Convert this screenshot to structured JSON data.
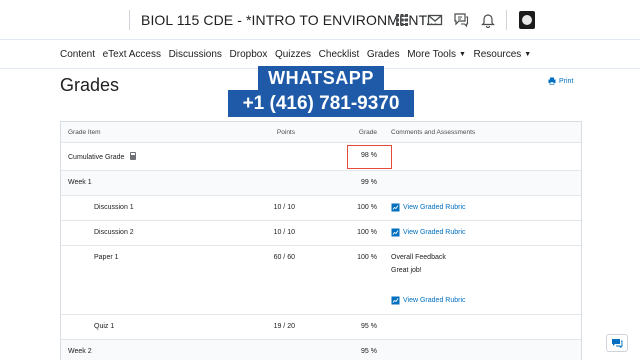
{
  "header": {
    "course_title": "BIOL 115 CDE - *INTRO TO ENVIRONMENT...",
    "icons": [
      "apps-grid-icon",
      "mail-icon",
      "chat-bubbles-icon",
      "bell-icon",
      "avatar"
    ]
  },
  "nav": {
    "items": [
      {
        "label": "Content"
      },
      {
        "label": "eText Access"
      },
      {
        "label": "Discussions"
      },
      {
        "label": "Dropbox"
      },
      {
        "label": "Quizzes"
      },
      {
        "label": "Checklist"
      },
      {
        "label": "Grades"
      },
      {
        "label": "More Tools",
        "dropdown": true
      },
      {
        "label": "Resources",
        "dropdown": true
      }
    ]
  },
  "page": {
    "title": "Grades",
    "print_label": "Print"
  },
  "watermark": {
    "line1": "WHATSAPP",
    "line2": "+1 (416) 781-9370"
  },
  "table": {
    "headers": {
      "item": "Grade Item",
      "points": "Points",
      "grade": "Grade",
      "comments": "Comments and Assessments"
    },
    "rows": [
      {
        "item": "Cumulative Grade",
        "points": "",
        "grade": "98 %",
        "comment": "",
        "rubric": ""
      },
      {
        "item": "Week 1",
        "points": "",
        "grade": "99 %",
        "comment": "",
        "rubric": ""
      },
      {
        "item": "Discussion 1",
        "points": "10 / 10",
        "grade": "100 %",
        "comment": "",
        "rubric": "View Graded Rubric"
      },
      {
        "item": "Discussion 2",
        "points": "10 / 10",
        "grade": "100 %",
        "comment": "",
        "rubric": "View Graded Rubric"
      },
      {
        "item": "Paper 1",
        "points": "60 / 60",
        "grade": "100 %",
        "comment_title": "Overall Feedback",
        "comment": "Great job!",
        "rubric": "View Graded Rubric"
      },
      {
        "item": "Quiz 1",
        "points": "19 / 20",
        "grade": "95 %",
        "comment": "",
        "rubric": ""
      },
      {
        "item": "Week 2",
        "points": "",
        "grade": "95 %",
        "comment": "",
        "rubric": ""
      }
    ]
  },
  "colors": {
    "link": "#006fbf",
    "highlight_box": "#e24a3b",
    "watermark_bg": "#1f5aa8"
  }
}
